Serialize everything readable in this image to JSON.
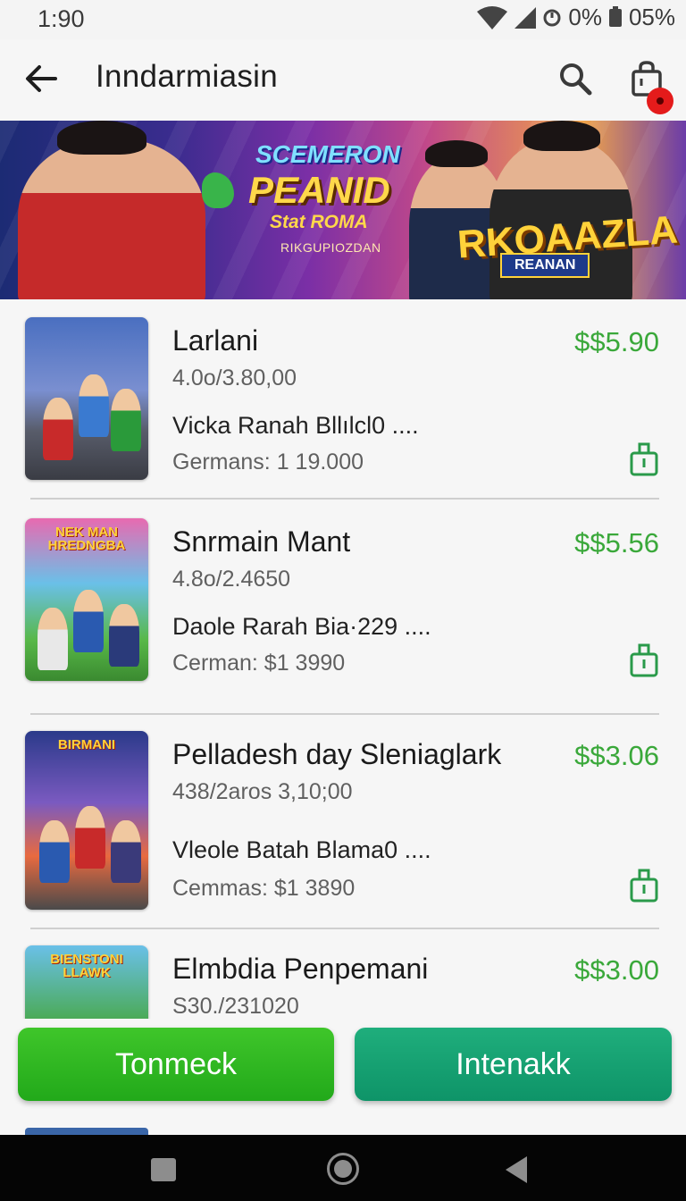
{
  "status": {
    "time": "1:90",
    "data_label": "0%",
    "battery": "05%"
  },
  "appbar": {
    "title": "Inndarmiasin",
    "icons": [
      "back-arrow-icon",
      "search-icon",
      "shopping-bag-icon"
    ]
  },
  "banner": {
    "line1": "SCEMERON",
    "line2": "PEANID",
    "line3": "Stat ROMA",
    "line4": "RIKGUPIOZDAN",
    "right_title": "RKOAAZLA",
    "right_badge": "REANAN"
  },
  "items": [
    {
      "name": "Larlani",
      "price": "$$5.90",
      "rating": "4.0o/3.80,00",
      "desc": "Vicka Ranah Bllılcl0  ....",
      "sub": "Germans: 1 19.000",
      "logo": ""
    },
    {
      "name": "Snrmain Mant",
      "price": "$$5.56",
      "rating": "4.8o/2.4650",
      "desc": "Daole Rarah Bia·229 ....",
      "sub": "Cerman: $1 3990",
      "logo": "NEK MAN HREDNGBA"
    },
    {
      "name": "Pelladesh day Sleniaglark",
      "price": "$$3.06",
      "rating": "438/2aros 3,10;00",
      "desc": "Vleole Batah Blama0 ....",
      "sub": "Cemmas: $1 3890",
      "logo": "BIRMANI"
    },
    {
      "name": "Elmbdia Penpemani",
      "price": "$$3.00",
      "rating": "S30./231020",
      "desc": "",
      "sub": "",
      "logo": "BIENSTONI LLAWK"
    }
  ],
  "buttons": {
    "left": "Tonmeck",
    "right": "Intenakk"
  },
  "colors": {
    "price": "#3aa83a",
    "btn_left": "#22a91a",
    "btn_right": "#0e9468",
    "badge": "#e41b1b"
  }
}
